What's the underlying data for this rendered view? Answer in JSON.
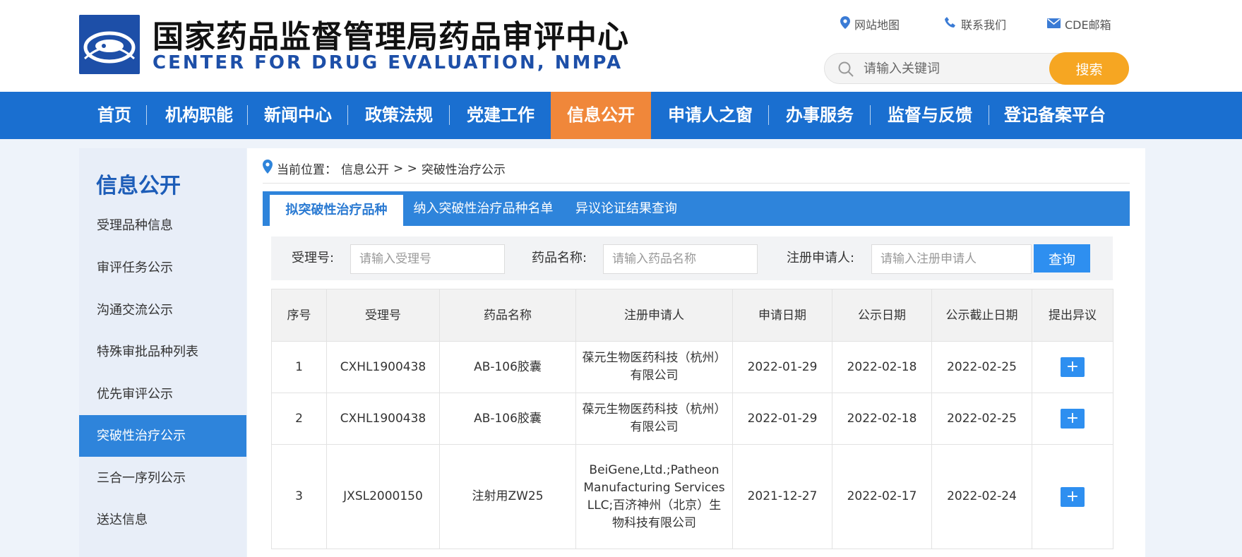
{
  "header": {
    "title_cn": "国家药品监督管理局药品审评中心",
    "title_en": "CENTER FOR DRUG EVALUATION, NMPA",
    "links": [
      {
        "label": "网站地图",
        "icon": "location-pin-icon"
      },
      {
        "label": "联系我们",
        "icon": "phone-icon"
      },
      {
        "label": "CDE邮箱",
        "icon": "mail-icon"
      }
    ],
    "search": {
      "placeholder": "请输入关键词",
      "button": "搜索"
    }
  },
  "nav": {
    "items": [
      "首页",
      "机构职能",
      "新闻中心",
      "政策法规",
      "党建工作",
      "信息公开",
      "申请人之窗",
      "办事服务",
      "监督与反馈",
      "登记备案平台"
    ],
    "active": "信息公开"
  },
  "sidebar": {
    "title": "信息公开",
    "items": [
      "受理品种信息",
      "审评任务公示",
      "沟通交流公示",
      "特殊审批品种列表",
      "优先审评公示",
      "突破性治疗公示",
      "三合一序列公示",
      "送达信息"
    ],
    "active": "突破性治疗公示"
  },
  "breadcrumb": {
    "label": "当前位置：",
    "path": "信息公开",
    "sep": "> >",
    "current": "突破性治疗公示"
  },
  "tabs": [
    "拟突破性治疗品种",
    "纳入突破性治疗品种名单",
    "异议论证结果查询"
  ],
  "filters": {
    "accept_no_label": "受理号:",
    "accept_no_placeholder": "请输入受理号",
    "drug_name_label": "药品名称:",
    "drug_name_placeholder": "请输入药品名称",
    "applicant_label": "注册申请人:",
    "applicant_placeholder": "请输入注册申请人",
    "query_button": "查询"
  },
  "table": {
    "headers": [
      "序号",
      "受理号",
      "药品名称",
      "注册申请人",
      "申请日期",
      "公示日期",
      "公示截止日期",
      "提出异议"
    ],
    "rows": [
      {
        "no": "1",
        "accept_no": "CXHL1900438",
        "drug": "AB-106胶囊",
        "applicant": "葆元生物医药科技（杭州）有限公司",
        "apply_date": "2022-01-29",
        "pub_date": "2022-02-18",
        "deadline": "2022-02-25",
        "action": "+"
      },
      {
        "no": "2",
        "accept_no": "CXHL1900438",
        "drug": "AB-106胶囊",
        "applicant": "葆元生物医药科技（杭州）有限公司",
        "apply_date": "2022-01-29",
        "pub_date": "2022-02-18",
        "deadline": "2022-02-25",
        "action": "+"
      },
      {
        "no": "3",
        "accept_no": "JXSL2000150",
        "drug": "注射用ZW25",
        "applicant": "BeiGene,Ltd.;Patheon Manufacturing Services LLC;百济神州（北京）生物科技有限公司",
        "apply_date": "2021-12-27",
        "pub_date": "2022-02-17",
        "deadline": "2022-02-24",
        "action": "+"
      }
    ]
  },
  "colors": {
    "nav_bg": "#1a6fd0",
    "nav_active": "#f0873a",
    "search_button": "#f6a622",
    "tab_bar": "#2e84db",
    "primary_button": "#2e8ff0",
    "title_blue": "#1d4fa8"
  }
}
